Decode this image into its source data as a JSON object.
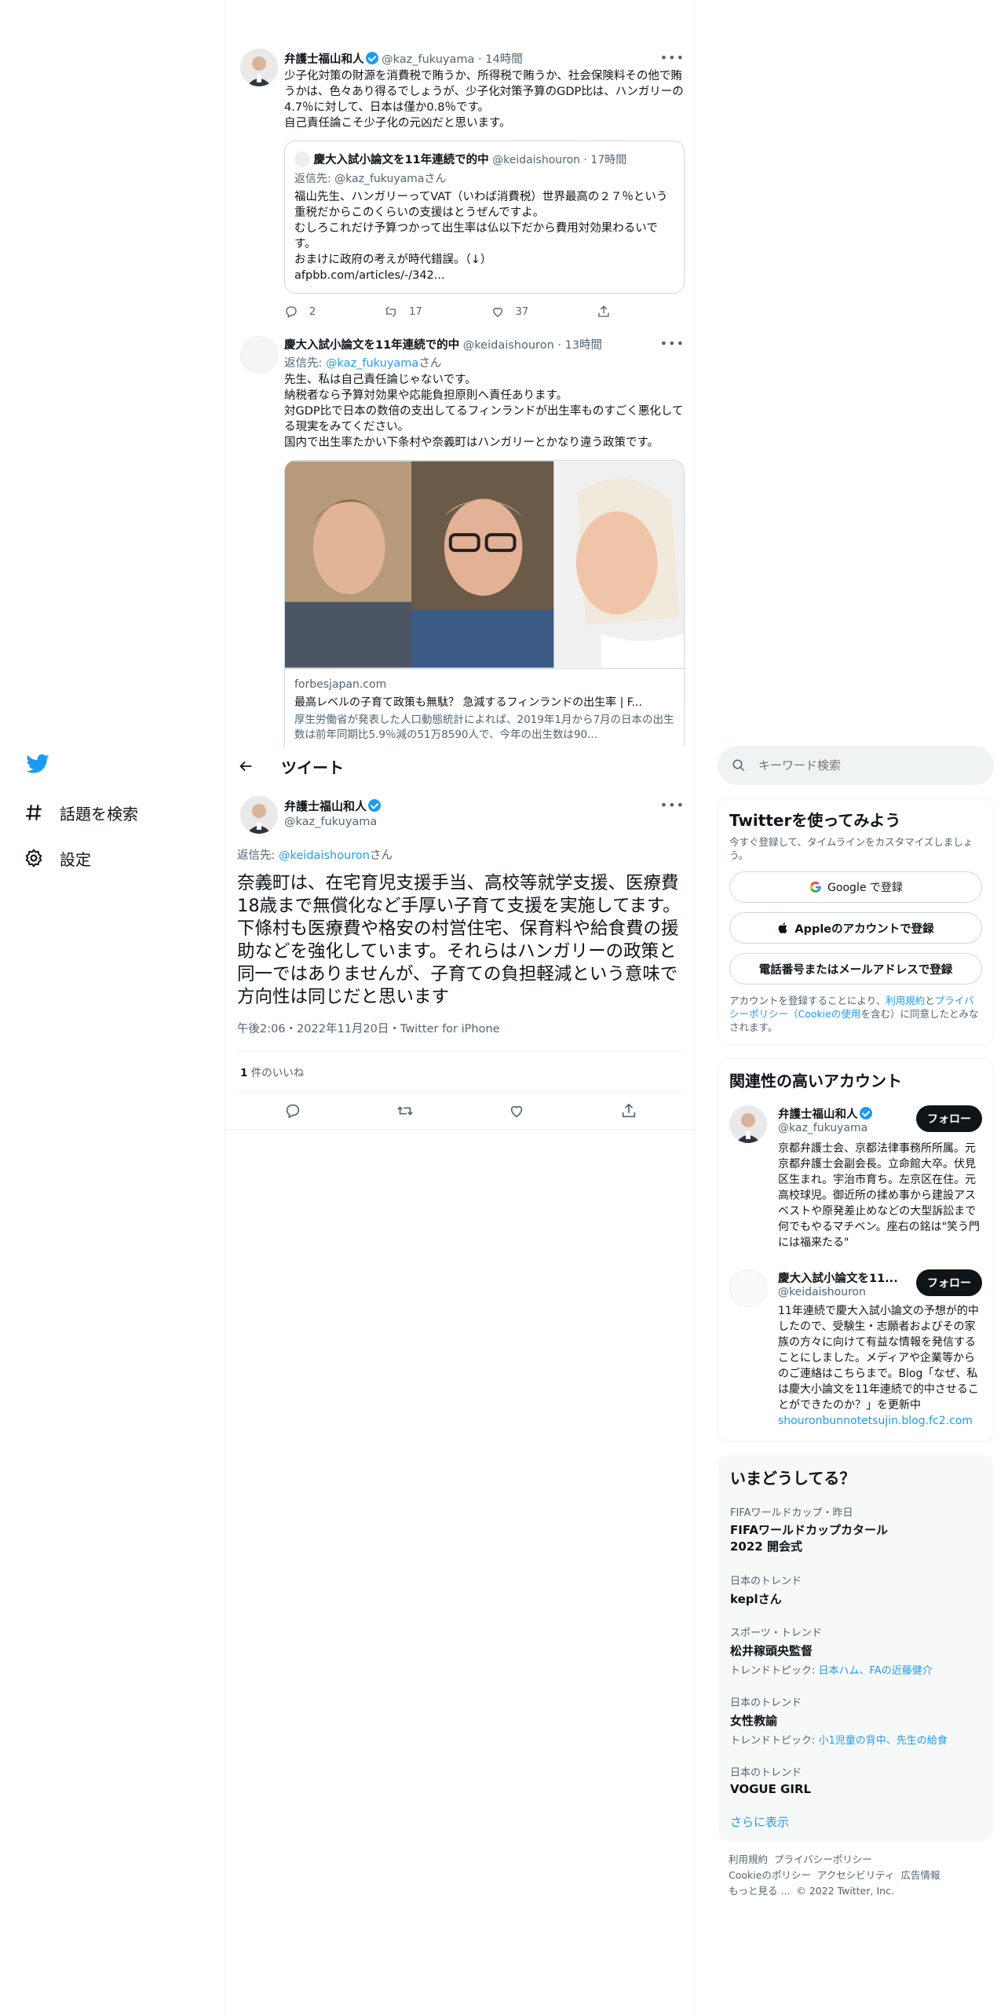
{
  "nav": {
    "explore": "話題を検索",
    "settings": "設定"
  },
  "header": {
    "title": "ツイート"
  },
  "search": {
    "placeholder": "キーワード検索"
  },
  "tweet1": {
    "name": "弁護士福山和人",
    "handle": "@kaz_fukuyama",
    "time": "14時間",
    "text": "少子化対策の財源を消費税で賄うか、所得税で賄うか、社会保険料その他で賄うかは、色々あり得るでしょうが、少子化対策予算のGDP比は、ハンガリーの4.7％に対して、日本は僅か0.8％です。\n自己責任論こそ少子化の元凶だと思います。",
    "quote": {
      "name": "慶大入試小論文を11年連続で的中",
      "handle": "@keidaishouron",
      "time": "17時間",
      "reply_prefix": "返信先: ",
      "reply_handle": "@kaz_fukuyama",
      "reply_suffix": "さん",
      "text": "福山先生、ハンガリーってVAT（いわば消費税）世界最高の２７％という重税だからこのくらいの支援はとうぜんですよ。\nむしろこれだけ予算つかって出生率は仏以下だから費用対効果わるいです。\nおまけに政府の考えが時代錯誤。（↓）\nafpbb.com/articles/-/342..."
    },
    "replies": "2",
    "retweets": "17",
    "likes": "37"
  },
  "tweet2": {
    "name": "慶大入試小論文を11年連続で的中",
    "handle": "@keidaishouron",
    "time": "13時間",
    "reply_prefix": "返信先: ",
    "reply_handle": "@kaz_fukuyama",
    "reply_suffix": "さん",
    "text": "先生、私は自己責任論じゃないです。\n納税者なら予算対効果や応能負担原則へ責任あります。\n対GDP比で日本の数倍の支出してるフィンランドが出生率ものすごく悪化してる現実をみてください。\n国内で出生率たかい下条村や奈義町はハンガリーとかなり違う政策です。",
    "link": {
      "domain": "forbesjapan.com",
      "title": "最高レベルの子育て政策も無駄？ 急減するフィンランドの出生率 | F...",
      "desc": "厚生労働省が発表した人口動態統計によれば、2019年1月から7月の日本の出生数は前年同期比5.9％減の51万8590人で、今年の出生数は90..."
    }
  },
  "main": {
    "name": "弁護士福山和人",
    "handle": "@kaz_fukuyama",
    "reply_prefix": "返信先: ",
    "reply_handle": "@keidaishouron",
    "reply_suffix": "さん",
    "text": "奈義町は、在宅育児支援手当、高校等就学支援、医療費18歳まで無償化など手厚い子育て支援を実施してます。下條村も医療費や格安の村営住宅、保育料や給食費の援助などを強化しています。それらはハンガリーの政策と同一ではありませんが、子育ての負担軽減という意味で方向性は同じだと思います",
    "meta": "午後2:06・2022年11月20日・Twitter for iPhone",
    "likes_count": "1",
    "likes_label": " 件のいいね"
  },
  "signup": {
    "title": "Twitterを使ってみよう",
    "subtitle": "今すぐ登録して、タイムラインをカスタマイズしましょう。",
    "google": "Google で登録",
    "apple": "Appleのアカウントで登録",
    "phone": "電話番号またはメールアドレスで登録",
    "legal_a": "アカウントを登録することにより、",
    "legal_terms": "利用規約",
    "legal_b": "と",
    "legal_privacy": "プライバシーポリシー（Cookieの使用",
    "legal_c": "を含む）に同意したとみなされます。"
  },
  "related": {
    "title": "関連性の高いアカウント",
    "follow": "フォロー",
    "a1": {
      "name": "弁護士福山和人",
      "handle": "@kaz_fukuyama",
      "bio": "京都弁護士会、京都法律事務所所属。元京都弁護士会副会長。立命館大卒。伏見区生まれ。宇治市育ち。左京区在住。元高校球児。御近所の揉め事から建設アスベストや原発差止めなどの大型訴訟まで何でもやるマチベン。座右の銘は\"笑う門には福来たる\""
    },
    "a2": {
      "name": "慶大入試小論文を11...",
      "handle": "@keidaishouron",
      "bio": "11年連続で慶大入試小論文の予想が的中したので、受験生・志願者およびその家族の方々に向けて有益な情報を発信することにしました。メディアや企業等からのご連絡はこちらまで。Blog「なぜ、私は慶大小論文を11年連続で的中させることができたのか？」を更新中",
      "link": "shouronbunnotetsujin.blog.fc2.com"
    }
  },
  "trends": {
    "title": "いまどうしてる？",
    "items": [
      {
        "cat": "FIFAワールドカップ・昨日",
        "t": "FIFAワールドカップカタール2022 開会式",
        "sub_label": "",
        "sub_link": ""
      },
      {
        "cat": "日本のトレンド",
        "t": "keplさん",
        "sub_label": "",
        "sub_link": ""
      },
      {
        "cat": "スポーツ・トレンド",
        "t": "松井稼頭央監督",
        "sub_label": "トレンドトピック: ",
        "sub_link": "日本ハム、FAの近藤健介"
      },
      {
        "cat": "日本のトレンド",
        "t": "女性教諭",
        "sub_label": "トレンドトピック: ",
        "sub_link": "小1児童の背中、先生の給食"
      },
      {
        "cat": "日本のトレンド",
        "t": "VOGUE GIRL",
        "sub_label": "",
        "sub_link": ""
      }
    ],
    "more": "さらに表示"
  },
  "footer": {
    "l1": "利用規約",
    "l2": "プライバシーポリシー",
    "l3": "Cookieのポリシー",
    "l4": "アクセシビリティ",
    "l5": "広告情報",
    "l6": "もっと見る ...",
    "copy": "© 2022 Twitter, Inc."
  }
}
